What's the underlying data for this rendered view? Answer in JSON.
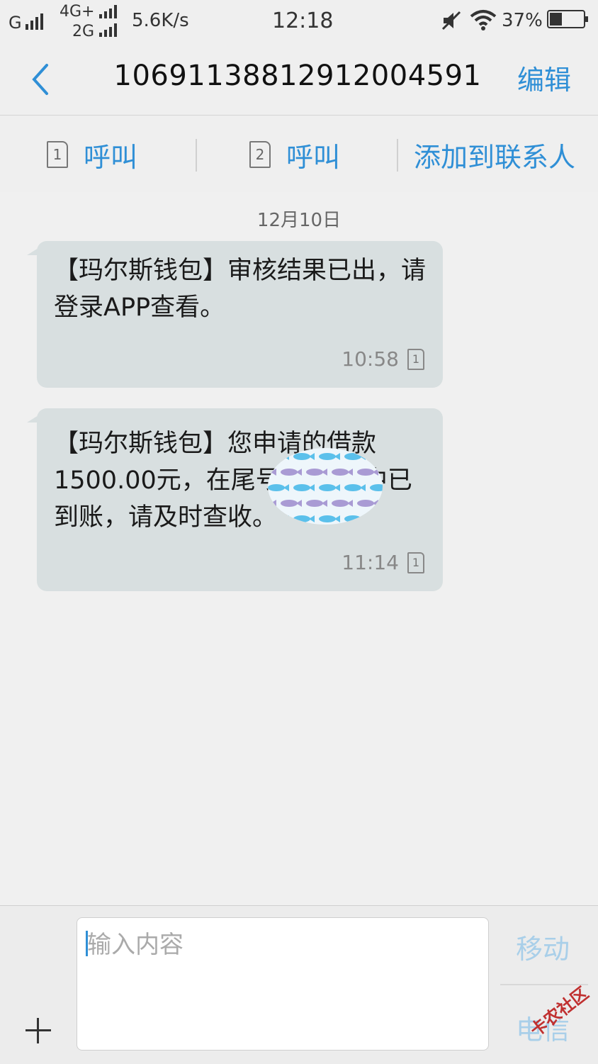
{
  "status_bar": {
    "network1": "G",
    "network2_top": "4G+",
    "network2_bottom": "2G",
    "speed": "5.6K/s",
    "time": "12:18",
    "battery": "37%",
    "battery_level": 0.37
  },
  "header": {
    "back_icon": "chevron-left-icon",
    "title": "1069113881291200459​1",
    "edit_label": "编辑"
  },
  "actions": {
    "call1_sim": "1",
    "call1_label": "呼叫",
    "call2_sim": "2",
    "call2_label": "呼叫",
    "add_contact_label": "添加到联系人"
  },
  "thread": {
    "date": "12月10日",
    "messages": [
      {
        "text": "【玛尔斯钱包】审核结果已出，请登录APP查看。",
        "time": "10:58",
        "sim": "1"
      },
      {
        "text": "【玛尔斯钱包】您申请的借款1500.00元，在尾号        银行卡中已到账，请及时查收。",
        "time": "11:14",
        "sim": "1"
      }
    ]
  },
  "composer": {
    "placeholder": "输入内容",
    "send_label": "移动",
    "send_label2": "电信",
    "watermark": "卡农社区"
  },
  "colors": {
    "accent": "#2f8fd6",
    "bubble": "#d8dfe0",
    "background": "#f0f0f0"
  }
}
